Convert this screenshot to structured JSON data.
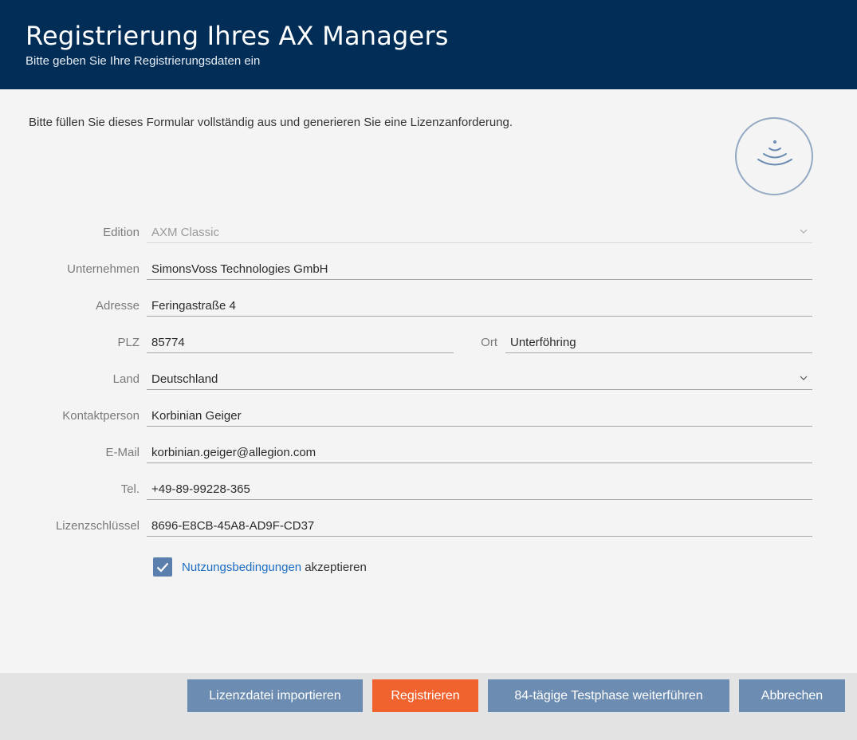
{
  "header": {
    "title": "Registrierung Ihres AX Managers",
    "subtitle": "Bitte geben Sie Ihre Registrierungsdaten ein"
  },
  "intro": "Bitte füllen Sie dieses Formular vollständig aus und generieren Sie eine Lizenzanforderung.",
  "logo_icon": "wireless-signal-icon",
  "form": {
    "edition": {
      "label": "Edition",
      "value": "AXM Classic"
    },
    "company": {
      "label": "Unternehmen",
      "value": "SimonsVoss Technologies GmbH"
    },
    "address": {
      "label": "Adresse",
      "value": "Feringastraße 4"
    },
    "zip": {
      "label": "PLZ",
      "value": "85774"
    },
    "city": {
      "label": "Ort",
      "value": "Unterföhring"
    },
    "country": {
      "label": "Land",
      "value": "Deutschland"
    },
    "contact": {
      "label": "Kontaktperson",
      "value": "Korbinian Geiger"
    },
    "email": {
      "label": "E-Mail",
      "value": "korbinian.geiger@allegion.com"
    },
    "phone": {
      "label": "Tel.",
      "value": "+49-89-99228-365"
    },
    "license_key": {
      "label": "Lizenzschlüssel",
      "value": "8696-E8CB-45A8-AD9F-CD37"
    }
  },
  "terms": {
    "checked": true,
    "link_text": "Nutzungsbedingungen",
    "suffix": " akzeptieren"
  },
  "buttons": {
    "import": "Lizenzdatei importieren",
    "register": "Registrieren",
    "trial": "84-tägige Testphase weiterführen",
    "cancel": "Abbrechen"
  },
  "colors": {
    "header_bg": "#012d56",
    "button_blue": "#6d8cb2",
    "button_orange": "#f0632f",
    "link": "#1b6cc2",
    "checkbox": "#5a7fac"
  }
}
